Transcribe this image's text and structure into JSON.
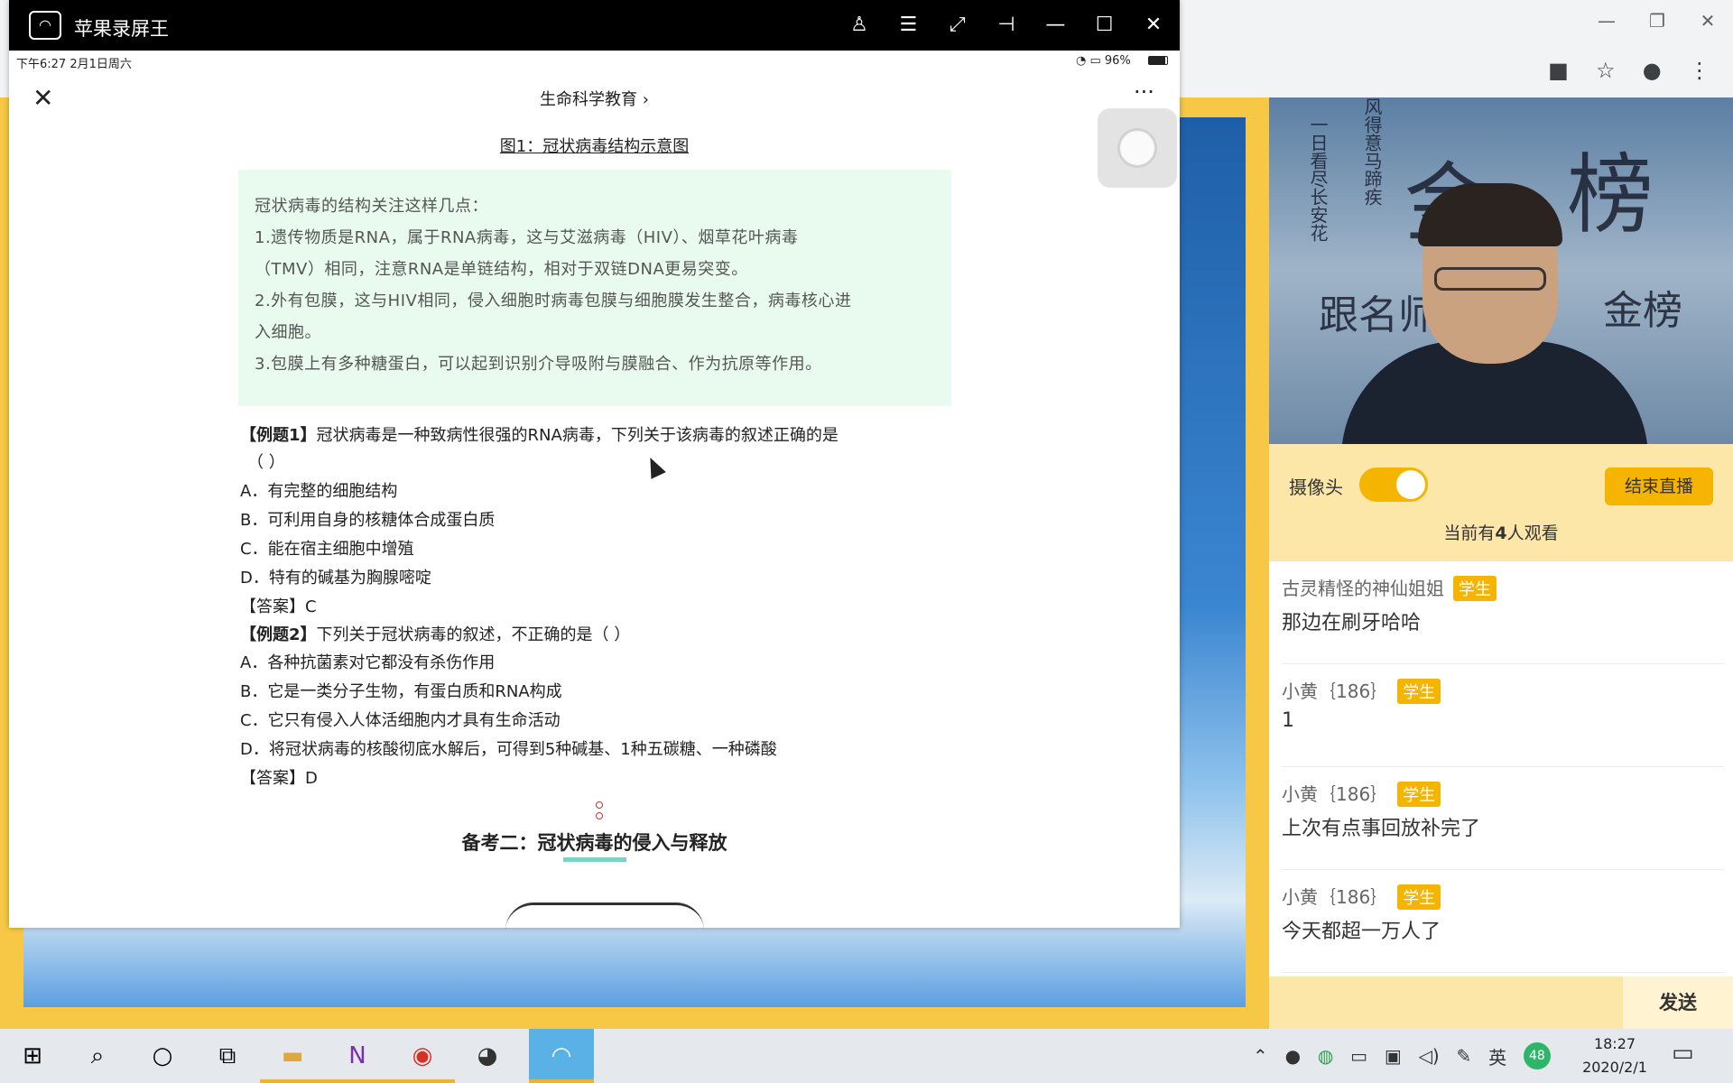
{
  "mirror_app": {
    "title": "苹果录屏王",
    "controls": [
      "user-icon",
      "list-icon",
      "expand-icon",
      "pin-icon",
      "minimize-icon",
      "maximize-icon",
      "close-icon"
    ]
  },
  "status_bar": {
    "time_date": "下午6:27  2月1日周六",
    "battery": "96%"
  },
  "app_bar": {
    "title": "生命科学教育 ›",
    "more": "···"
  },
  "document": {
    "figure_caption": "图1：冠状病毒结构示意图",
    "note": [
      "冠状病毒的结构关注这样几点：",
      "1.遗传物质是RNA，属于RNA病毒，这与艾滋病毒（HIV）、烟草花叶病毒",
      "（TMV）相同，注意RNA是单链结构，相对于双链DNA更易突变。",
      "2.外有包膜，这与HIV相同，侵入细胞时病毒包膜与细胞膜发生整合，病毒核心进",
      "入细胞。",
      "3.包膜上有多种糖蛋白，可以起到识别介导吸附与膜融合、作为抗原等作用。"
    ],
    "example1": {
      "label": "【例题1】",
      "question": "冠状病毒是一种致病性很强的RNA病毒，下列关于该病毒的叙述正确的是",
      "blank": "（ ）",
      "options": [
        "A．有完整的细胞结构",
        "B．可利用自身的核糖体合成蛋白质",
        "C．能在宿主细胞中增殖",
        "D．特有的碱基为胸腺嘧啶"
      ],
      "answer": "【答案】C"
    },
    "example2": {
      "label": "【例题2】",
      "question": "下列关于冠状病毒的叙述，不正确的是（ ）",
      "options": [
        "A．各种抗菌素对它都没有杀伤作用",
        "B．它是一类分子生物，有蛋白质和RNA构成",
        "C．它只有侵入人体活细胞内才具有生命活动",
        "D．将冠状病毒的核酸彻底水解后，可得到5种碱基、1种五碳糖、一种磷酸"
      ],
      "answer": "【答案】D"
    },
    "section_title": "备考二：冠状病毒的侵入与释放"
  },
  "live": {
    "camera_label": "摄像头",
    "camera_on": true,
    "end_button": "结束直播",
    "viewer_prefix": "当前有",
    "viewer_count": "4",
    "viewer_suffix": "人观看",
    "chat": [
      {
        "user": "古灵精怪的神仙姐姐",
        "badge": "学生",
        "text": "那边在刷牙哈哈"
      },
      {
        "user": "小黄｛186｝",
        "badge": "学生",
        "text": "1"
      },
      {
        "user": "小黄｛186｝",
        "badge": "学生",
        "text": "上次有点事回放补完了"
      },
      {
        "user": "小黄｛186｝",
        "badge": "学生",
        "text": "今天都超一万人了"
      }
    ],
    "send_button": "发送"
  },
  "video_calligraphy": [
    "金",
    "榜",
    "风得意马蹄疾",
    "一日看尽长安花",
    "跟名师",
    "金榜"
  ],
  "taskbar": {
    "ime": "英",
    "badge": "48",
    "time": "18:27",
    "date": "2020/2/1"
  },
  "colors": {
    "accent_yellow": "#f5b400",
    "note_bg": "#e9fbef",
    "section_underline": "#7fd1c7"
  }
}
